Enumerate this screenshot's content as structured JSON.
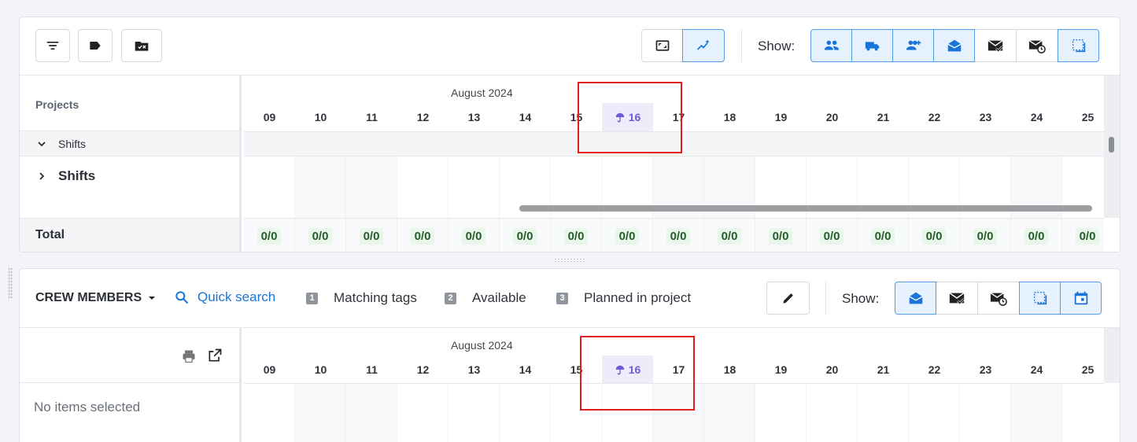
{
  "top": {
    "toolbar": {
      "filter_icon": "filter-icon",
      "tag_icon": "tag-icon",
      "folder_icon": "folder-close-icon",
      "show_label": "Show:"
    },
    "grid": {
      "column_header": "Projects",
      "group_label": "Shifts",
      "row_label": "Shifts",
      "total_label": "Total"
    },
    "timeline": {
      "month": "August 2024",
      "days": [
        "09",
        "10",
        "11",
        "12",
        "13",
        "14",
        "15",
        "16",
        "17",
        "18",
        "19",
        "20",
        "21",
        "22",
        "23",
        "24",
        "25"
      ],
      "today_index": 7,
      "totals": [
        "0/0",
        "0/0",
        "0/0",
        "0/0",
        "0/0",
        "0/0",
        "0/0",
        "0/0",
        "0/0",
        "0/0",
        "0/0",
        "0/0",
        "0/0",
        "0/0",
        "0/0",
        "0/0",
        "0/0"
      ]
    }
  },
  "bottom": {
    "toolbar": {
      "crew_label": "CREW MEMBERS",
      "quick_search": "Quick search",
      "legend": [
        {
          "num": "1",
          "label": "Matching tags"
        },
        {
          "num": "2",
          "label": "Available"
        },
        {
          "num": "3",
          "label": "Planned in project"
        }
      ],
      "show_label": "Show:"
    },
    "grid": {
      "empty_text": "No items selected"
    },
    "timeline": {
      "month": "August 2024",
      "days": [
        "09",
        "10",
        "11",
        "12",
        "13",
        "14",
        "15",
        "16",
        "17",
        "18",
        "19",
        "20",
        "21",
        "22",
        "23",
        "24",
        "25"
      ],
      "today_index": 7
    }
  },
  "colors": {
    "accent": "#1a73d9",
    "today_bg": "#eeebfb",
    "today_text": "#6b5bd6",
    "total_pill_bg": "#e9f6ea",
    "annotation": "#e01e1e"
  }
}
